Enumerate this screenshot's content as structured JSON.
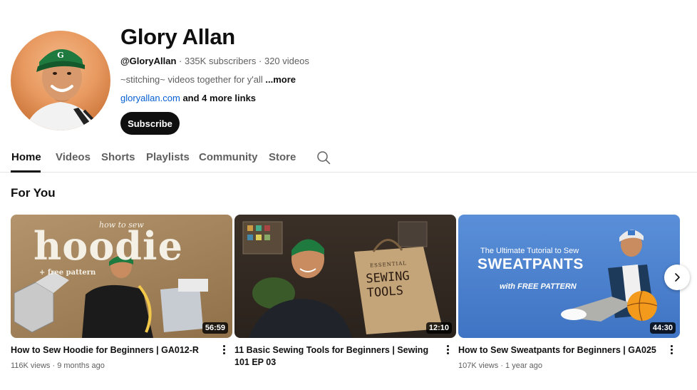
{
  "channel": {
    "name": "Glory Allan",
    "handle": "@GloryAllan",
    "stats": " · 335K subscribers · 320 videos",
    "description": "~stitching~ videos together for y'all ",
    "description_more": "...more",
    "link": "gloryallan.com",
    "more_links": " and 4 more links",
    "subscribe_label": "Subscribe"
  },
  "tabs": [
    {
      "label": "Home",
      "active": true
    },
    {
      "label": "Videos"
    },
    {
      "label": "Shorts"
    },
    {
      "label": "Playlists"
    },
    {
      "label": "Community"
    },
    {
      "label": "Store"
    }
  ],
  "section": {
    "title": "For You"
  },
  "videos": [
    {
      "title": "How to Sew Hoodie for Beginners | GA012-R",
      "views": "116K views",
      "age": "9 months ago",
      "duration": "56:59",
      "thumb_text": {
        "top": "how to sew",
        "main": "hoodie",
        "sub": "+ free pattern"
      }
    },
    {
      "title": "11 Basic Sewing Tools for Beginners | Sewing 101 EP 03",
      "views": "",
      "age": "",
      "duration": "12:10",
      "thumb_text": {
        "bag_small": "ESSENTIAL",
        "bag_big": "SEWING TOOLS"
      }
    },
    {
      "title": "How to Sew Sweatpants for Beginners | GA025",
      "views": "107K views",
      "age": "1 year ago",
      "duration": "44:30",
      "thumb_text": {
        "line1": "The Ultimate Tutorial to Sew",
        "main": "SWEATPANTS",
        "sub": "with FREE PATTERN"
      }
    }
  ],
  "colors": {
    "accent": "#0f0f0f",
    "link": "#065fd4",
    "secondary_text": "#606060"
  },
  "icons": {
    "search": "search-icon",
    "more": "more-vert-icon",
    "next": "chevron-right-icon"
  }
}
